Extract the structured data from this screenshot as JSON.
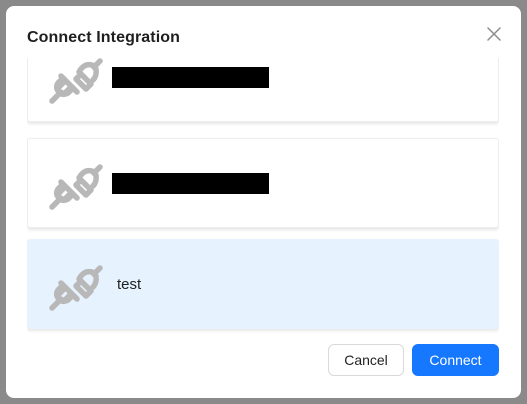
{
  "dialog": {
    "title": "Connect Integration"
  },
  "integrations": [
    {
      "name": "",
      "redacted": true,
      "selected": false,
      "icon": "plug-icon"
    },
    {
      "name": "",
      "redacted": true,
      "selected": false,
      "icon": "plug-icon"
    },
    {
      "name": "test",
      "redacted": false,
      "selected": true,
      "icon": "plug-icon"
    }
  ],
  "buttons": {
    "cancel_label": "Cancel",
    "connect_label": "Connect"
  },
  "colors": {
    "primary": "#1677ff",
    "selected_bg": "#e6f3ff",
    "icon": "#b8b8b8"
  }
}
